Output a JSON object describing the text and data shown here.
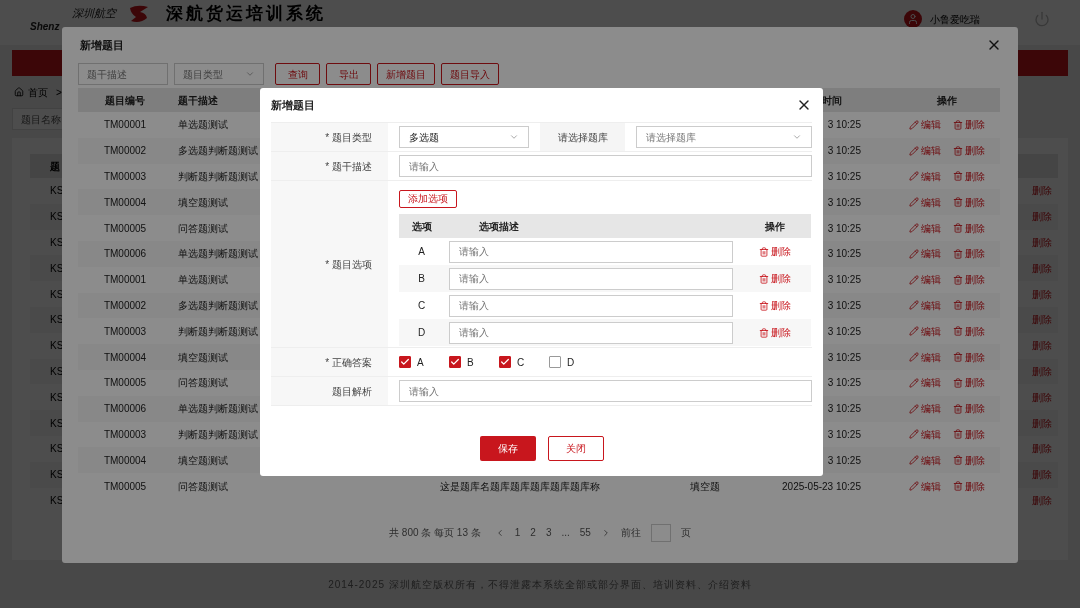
{
  "background_page": {
    "logo_text": "深圳航空",
    "logo_subtext": "Shenz",
    "system_title": "深航货运培训系统",
    "user_name": "小鲁爱吃瑞",
    "breadcrumb": "首页",
    "breadcrumb_separator": ">",
    "search_placeholder": "题目名称",
    "table_header": "题",
    "rows": [
      {
        "code": "KS",
        "action": "删除"
      },
      {
        "code": "KS",
        "action": "删除"
      },
      {
        "code": "KS",
        "action": "删除"
      },
      {
        "code": "KS",
        "action": "删除"
      },
      {
        "code": "KS",
        "action": "删除"
      },
      {
        "code": "KS",
        "action": "删除"
      },
      {
        "code": "KS",
        "action": "删除"
      },
      {
        "code": "KS",
        "action": "删除"
      },
      {
        "code": "KS",
        "action": "删除"
      },
      {
        "code": "KS",
        "action": "删除"
      },
      {
        "code": "KS",
        "action": "删除"
      },
      {
        "code": "KS",
        "action": "删除"
      },
      {
        "code": "KS",
        "action": "删除"
      }
    ],
    "footer": "2014-2025 深圳航空版权所有，不得泄露本系统全部或部分界面、培训资料、介绍资料"
  },
  "question_list_dialog": {
    "title": "新增题目",
    "filters": [
      {
        "kind": "input",
        "placeholder": "题干描述"
      },
      {
        "kind": "select",
        "placeholder": "题目类型"
      }
    ],
    "buttons": [
      "查询",
      "导出",
      "新增题目",
      "题目导入"
    ],
    "columns": {
      "id": "题目编号",
      "description": "题干描述",
      "time": "时间",
      "actions": "操作"
    },
    "rows": [
      {
        "id": "TM00001",
        "description": "单选题测试",
        "time": "3 10:25",
        "edit": "编辑",
        "delete": "删除"
      },
      {
        "id": "TM00002",
        "description": "多选题判断题测试",
        "time": "3 10:25",
        "edit": "编辑",
        "delete": "删除"
      },
      {
        "id": "TM00003",
        "description": "判断题判断题测试",
        "time": "3 10:25",
        "edit": "编辑",
        "delete": "删除"
      },
      {
        "id": "TM00004",
        "description": "填空题测试",
        "time": "3 10:25",
        "edit": "编辑",
        "delete": "删除"
      },
      {
        "id": "TM00005",
        "description": "问答题测试",
        "time": "3 10:25",
        "edit": "编辑",
        "delete": "删除"
      },
      {
        "id": "TM00006",
        "description": "单选题判断题测试",
        "time": "3 10:25",
        "edit": "编辑",
        "delete": "删除"
      },
      {
        "id": "TM00001",
        "description": "单选题测试",
        "time": "3 10:25",
        "edit": "编辑",
        "delete": "删除"
      },
      {
        "id": "TM00002",
        "description": "多选题判断题测试",
        "time": "3 10:25",
        "edit": "编辑",
        "delete": "删除"
      },
      {
        "id": "TM00003",
        "description": "判断题判断题测试",
        "time": "3 10:25",
        "edit": "编辑",
        "delete": "删除"
      },
      {
        "id": "TM00004",
        "description": "填空题测试",
        "time": "3 10:25",
        "edit": "编辑",
        "delete": "删除"
      },
      {
        "id": "TM00005",
        "description": "问答题测试",
        "time": "3 10:25",
        "edit": "编辑",
        "delete": "删除"
      },
      {
        "id": "TM00006",
        "description": "单选题判断题测试",
        "time": "3 10:25",
        "edit": "编辑",
        "delete": "删除"
      },
      {
        "id": "TM00003",
        "description": "判断题判断题测试",
        "time": "3 10:25",
        "edit": "编辑",
        "delete": "删除"
      },
      {
        "id": "TM00004",
        "description": "填空题测试",
        "time": "3 10:25",
        "edit": "编辑",
        "delete": "删除"
      },
      {
        "id": "TM00005",
        "description": "问答题测试",
        "bank": "这是题库名题库题库题库题库题库称",
        "type": "填空题",
        "time": "2025-05-23 10:25",
        "edit": "编辑",
        "delete": "删除"
      }
    ],
    "pagination": {
      "summary": "共 800 条 每页 13 条",
      "pages": [
        "1",
        "2",
        "3",
        "...",
        "55"
      ],
      "goto_label": "前往",
      "page_unit": "页"
    }
  },
  "add_question_dialog": {
    "title": "新增题目",
    "type_label": "题目类型",
    "type_value": "多选题",
    "bank_label": "请选择题库",
    "bank_placeholder": "请选择题库",
    "stem_label": "题干描述",
    "stem_placeholder": "请输入",
    "options_label": "题目选项",
    "add_option": "添加选项",
    "option_columns": [
      "选项",
      "选项描述",
      "操作"
    ],
    "options": [
      {
        "letter": "A",
        "placeholder": "请输入",
        "action": "删除"
      },
      {
        "letter": "B",
        "placeholder": "请输入",
        "action": "删除"
      },
      {
        "letter": "C",
        "placeholder": "请输入",
        "action": "删除"
      },
      {
        "letter": "D",
        "placeholder": "请输入",
        "action": "删除"
      }
    ],
    "answer_label": "正确答案",
    "answers": [
      {
        "label": "A",
        "checked": true
      },
      {
        "label": "B",
        "checked": true
      },
      {
        "label": "C",
        "checked": true
      },
      {
        "label": "D",
        "checked": false
      }
    ],
    "analysis_label": "题目解析",
    "analysis_placeholder": "请输入",
    "required_mark": "*",
    "save": "保存",
    "close": "关闭"
  }
}
